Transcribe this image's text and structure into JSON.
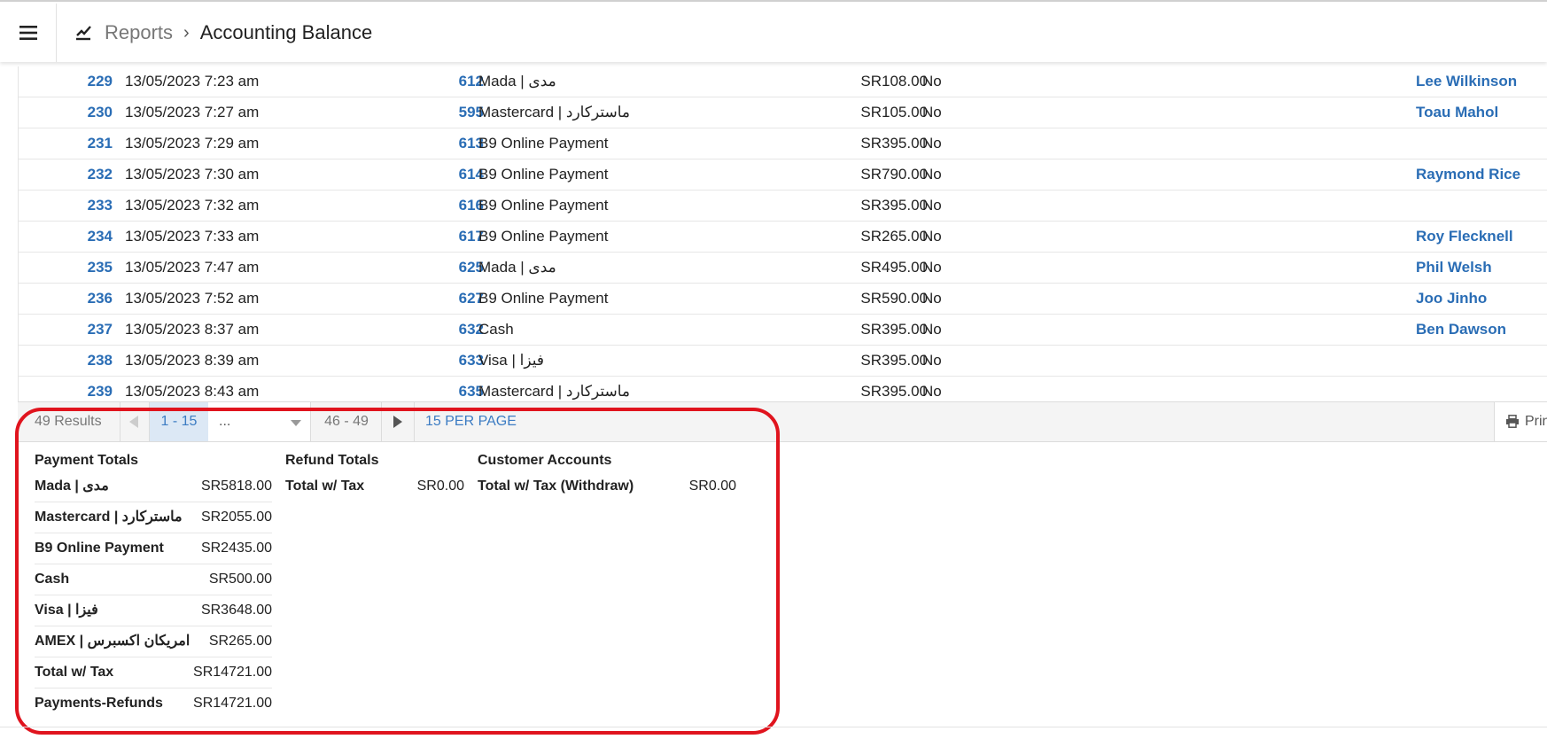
{
  "header": {
    "crumb_parent": "Reports",
    "crumb_separator": "›",
    "crumb_current": "Accounting Balance"
  },
  "rows": [
    {
      "id": "229",
      "date": "13/05/2023 7:23 am",
      "order": "612",
      "method": "Mada | مدى",
      "amount": "SR108.00",
      "flag": "No",
      "customer": "Lee Wilkinson"
    },
    {
      "id": "230",
      "date": "13/05/2023 7:27 am",
      "order": "595",
      "method": "Mastercard | ماستركارد",
      "amount": "SR105.00",
      "flag": "No",
      "customer": "Toau Mahol"
    },
    {
      "id": "231",
      "date": "13/05/2023 7:29 am",
      "order": "613",
      "method": "B9 Online Payment",
      "amount": "SR395.00",
      "flag": "No",
      "customer": ""
    },
    {
      "id": "232",
      "date": "13/05/2023 7:30 am",
      "order": "614",
      "method": "B9 Online Payment",
      "amount": "SR790.00",
      "flag": "No",
      "customer": "Raymond Rice"
    },
    {
      "id": "233",
      "date": "13/05/2023 7:32 am",
      "order": "616",
      "method": "B9 Online Payment",
      "amount": "SR395.00",
      "flag": "No",
      "customer": ""
    },
    {
      "id": "234",
      "date": "13/05/2023 7:33 am",
      "order": "617",
      "method": "B9 Online Payment",
      "amount": "SR265.00",
      "flag": "No",
      "customer": "Roy Flecknell"
    },
    {
      "id": "235",
      "date": "13/05/2023 7:47 am",
      "order": "625",
      "method": "Mada | مدى",
      "amount": "SR495.00",
      "flag": "No",
      "customer": "Phil Welsh"
    },
    {
      "id": "236",
      "date": "13/05/2023 7:52 am",
      "order": "627",
      "method": "B9 Online Payment",
      "amount": "SR590.00",
      "flag": "No",
      "customer": "Joo Jinho"
    },
    {
      "id": "237",
      "date": "13/05/2023 8:37 am",
      "order": "632",
      "method": "Cash",
      "amount": "SR395.00",
      "flag": "No",
      "customer": "Ben Dawson"
    },
    {
      "id": "238",
      "date": "13/05/2023 8:39 am",
      "order": "633",
      "method": "Visa | فيزا",
      "amount": "SR395.00",
      "flag": "No",
      "customer": ""
    },
    {
      "id": "239",
      "date": "13/05/2023 8:43 am",
      "order": "635",
      "method": "Mastercard | ماستركارد",
      "amount": "SR395.00",
      "flag": "No",
      "customer": ""
    }
  ],
  "pager": {
    "results": "49 Results",
    "current_range": "1 - 15",
    "select_value": "...",
    "last_range": "46 - 49",
    "per_page": "15 PER PAGE",
    "print": "Print"
  },
  "totals": {
    "payment": {
      "title": "Payment Totals",
      "rows": [
        {
          "label": "Mada | مدى",
          "value": "SR5818.00"
        },
        {
          "label": "Mastercard | ماستركارد",
          "value": "SR2055.00"
        },
        {
          "label": "B9 Online Payment",
          "value": "SR2435.00"
        },
        {
          "label": "Cash",
          "value": "SR500.00"
        },
        {
          "label": "Visa | فيزا",
          "value": "SR3648.00"
        },
        {
          "label": "AMEX | امريكان اكسبرس",
          "value": "SR265.00"
        },
        {
          "label": "Total w/ Tax",
          "value": "SR14721.00"
        },
        {
          "label": "Payments-Refunds",
          "value": "SR14721.00"
        }
      ]
    },
    "refund": {
      "title": "Refund Totals",
      "rows": [
        {
          "label": "Total w/ Tax",
          "value": "SR0.00"
        }
      ]
    },
    "customer": {
      "title": "Customer Accounts",
      "rows": [
        {
          "label": "Total w/ Tax (Withdraw)",
          "value": "SR0.00"
        }
      ]
    }
  },
  "colors": {
    "link": "#2a6db5",
    "highlight": "#e0141e",
    "pager_active_bg": "#dce8f5"
  }
}
